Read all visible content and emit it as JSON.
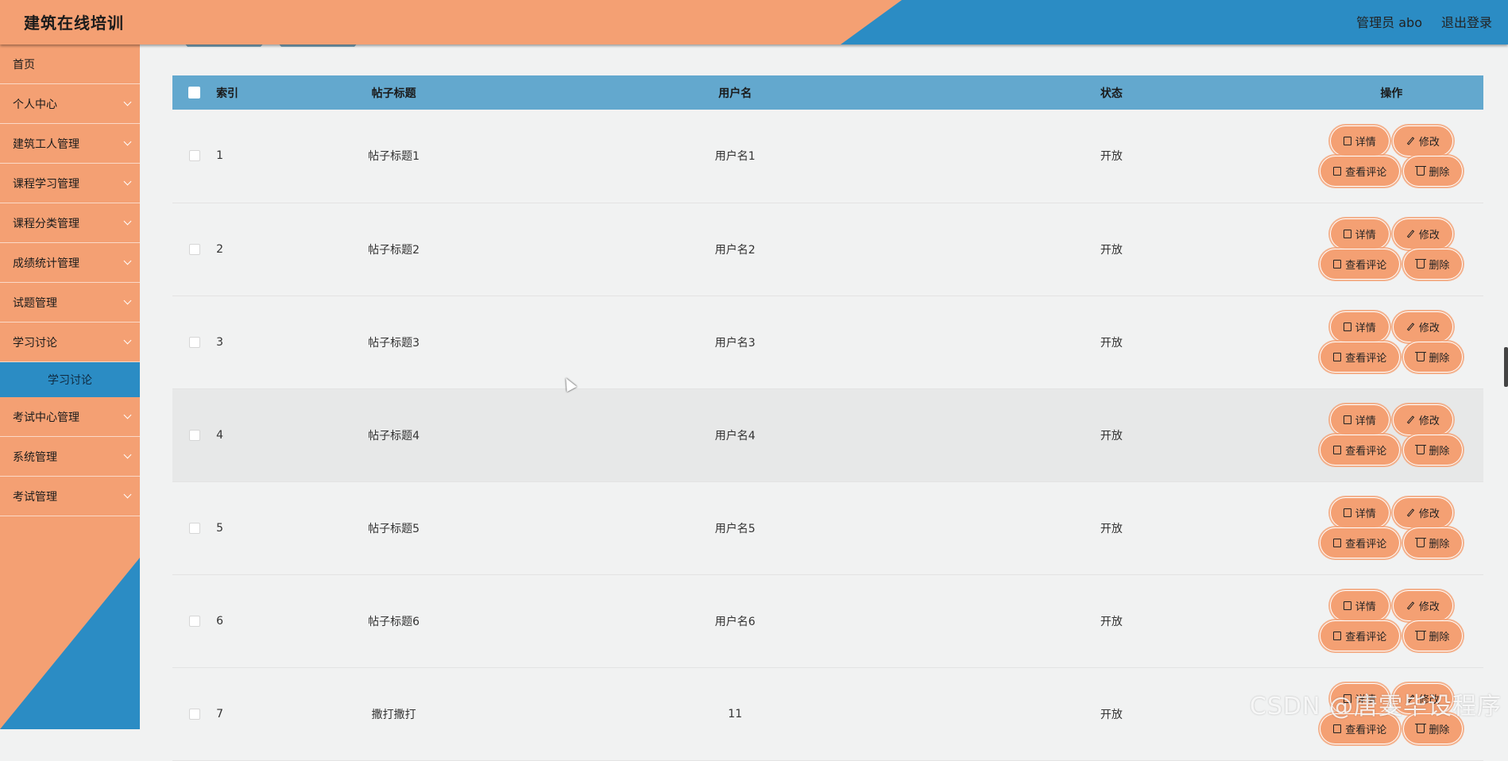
{
  "header": {
    "title": "建筑在线培训",
    "user_label": "管理员 abo",
    "logout_label": "退出登录"
  },
  "sidebar": {
    "items": [
      {
        "label": "首页",
        "chevron": false
      },
      {
        "label": "个人中心",
        "chevron": true
      },
      {
        "label": "建筑工人管理",
        "chevron": true
      },
      {
        "label": "课程学习管理",
        "chevron": true
      },
      {
        "label": "课程分类管理",
        "chevron": true
      },
      {
        "label": "成绩统计管理",
        "chevron": true
      },
      {
        "label": "试题管理",
        "chevron": true
      },
      {
        "label": "学习讨论",
        "chevron": true
      }
    ],
    "active_sub": "学习讨论",
    "items_after": [
      {
        "label": "考试中心管理"
      },
      {
        "label": "系统管理"
      },
      {
        "label": "考试管理"
      }
    ]
  },
  "table": {
    "headers": {
      "index": "索引",
      "title": "帖子标题",
      "username": "用户名",
      "status": "状态",
      "ops": "操作"
    },
    "rows": [
      {
        "index": "1",
        "title": "帖子标题1",
        "username": "用户名1",
        "status": "开放"
      },
      {
        "index": "2",
        "title": "帖子标题2",
        "username": "用户名2",
        "status": "开放"
      },
      {
        "index": "3",
        "title": "帖子标题3",
        "username": "用户名3",
        "status": "开放"
      },
      {
        "index": "4",
        "title": "帖子标题4",
        "username": "用户名4",
        "status": "开放"
      },
      {
        "index": "5",
        "title": "帖子标题5",
        "username": "用户名5",
        "status": "开放"
      },
      {
        "index": "6",
        "title": "帖子标题6",
        "username": "用户名6",
        "status": "开放"
      },
      {
        "index": "7",
        "title": "撒打撒打",
        "username": "11",
        "status": "开放"
      }
    ],
    "highlighted_row": 4,
    "actions": {
      "detail": "详情",
      "edit": "修改",
      "comments": "查看评论",
      "delete": "删除"
    }
  },
  "watermark": "CSDN @唐雯毕设程序",
  "colors": {
    "accent_orange": "#f4a073",
    "accent_blue": "#2b8cc4",
    "table_header": "#63a8ce"
  }
}
